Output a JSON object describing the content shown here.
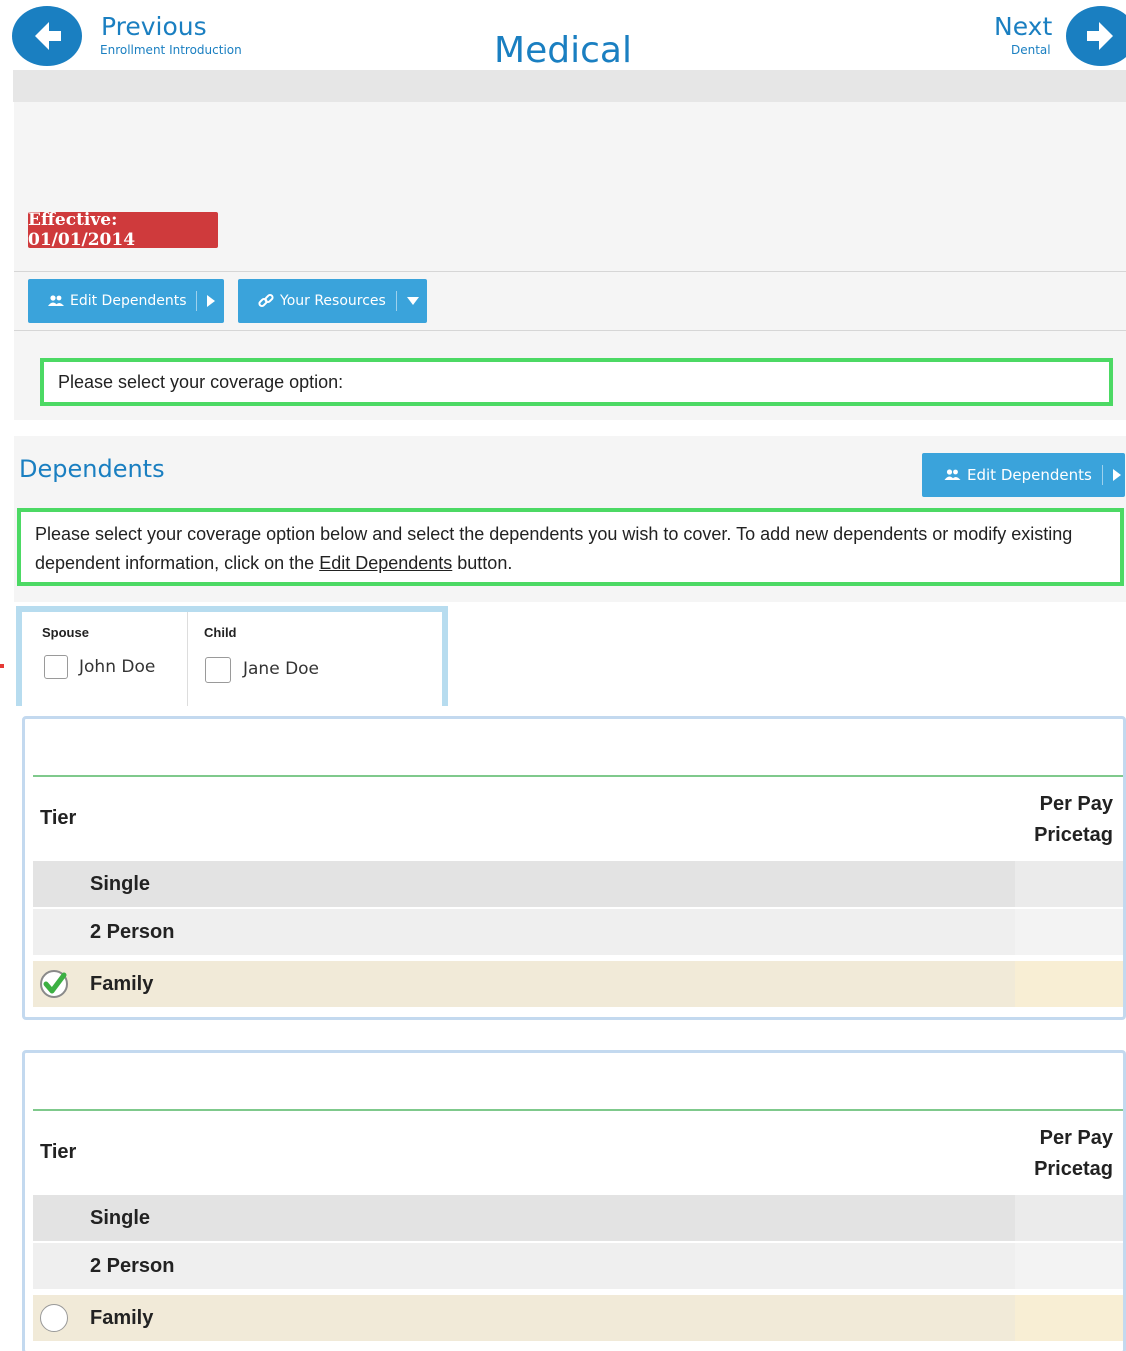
{
  "nav": {
    "previous_label": "Previous",
    "previous_sub": "Enrollment Introduction",
    "next_label": "Next",
    "next_sub": "Dental"
  },
  "page": {
    "title": "Medical",
    "effective": "Effective: 01/01/2014"
  },
  "toolbar": {
    "edit_dependents": "Edit Dependents",
    "your_resources": "Your Resources"
  },
  "notice_coverage": "Please select your coverage option:",
  "dependents": {
    "heading": "Dependents",
    "edit_button": "Edit Dependents",
    "instructions_part1": "Please select your coverage option below and select the dependents you wish to cover. To add new dependents or modify existing dependent information, click on the ",
    "instructions_link": "Edit Dependents",
    "instructions_part2": " button.",
    "groups": [
      {
        "label": "Spouse",
        "name": "John Doe",
        "checked": false
      },
      {
        "label": "Child",
        "name": "Jane Doe",
        "checked": false
      }
    ]
  },
  "plans": [
    {
      "header_tier": "Tier",
      "header_price_line1": "Per Pay",
      "header_price_line2": "Pricetag",
      "tiers": [
        "Single",
        "2 Person",
        "Family"
      ],
      "selected": "Family"
    },
    {
      "header_tier": "Tier",
      "header_price_line1": "Per Pay",
      "header_price_line2": "Pricetag",
      "tiers": [
        "Single",
        "2 Person",
        "Family"
      ],
      "selected": null
    }
  ],
  "colors": {
    "brand_blue": "#1a7fc1",
    "button_blue": "#3aa3db",
    "effective_red": "#cf3a3c",
    "notice_green": "#4cd964"
  }
}
